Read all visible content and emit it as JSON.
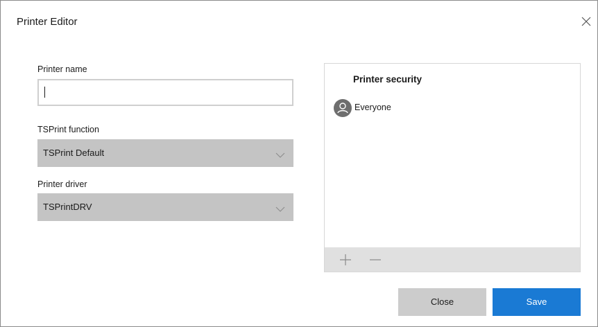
{
  "window": {
    "title": "Printer Editor",
    "close_icon": "close-icon"
  },
  "form": {
    "printer_name_label": "Printer name",
    "printer_name_value": "",
    "function_label": "TSPrint function",
    "function_value": "TSPrint Default",
    "driver_label": "Printer driver",
    "driver_value": "TSPrintDRV"
  },
  "security": {
    "title": "Printer security",
    "items": [
      {
        "name": "Everyone",
        "icon": "user-icon"
      }
    ],
    "toolbar": {
      "add_icon": "plus-icon",
      "remove_icon": "minus-icon"
    }
  },
  "buttons": {
    "close_label": "Close",
    "save_label": "Save"
  },
  "colors": {
    "accent": "#1a7ad4",
    "select_bg": "#c4c4c4",
    "secondary_button": "#cccccc",
    "toolbar_bg": "#e0e0e0"
  }
}
